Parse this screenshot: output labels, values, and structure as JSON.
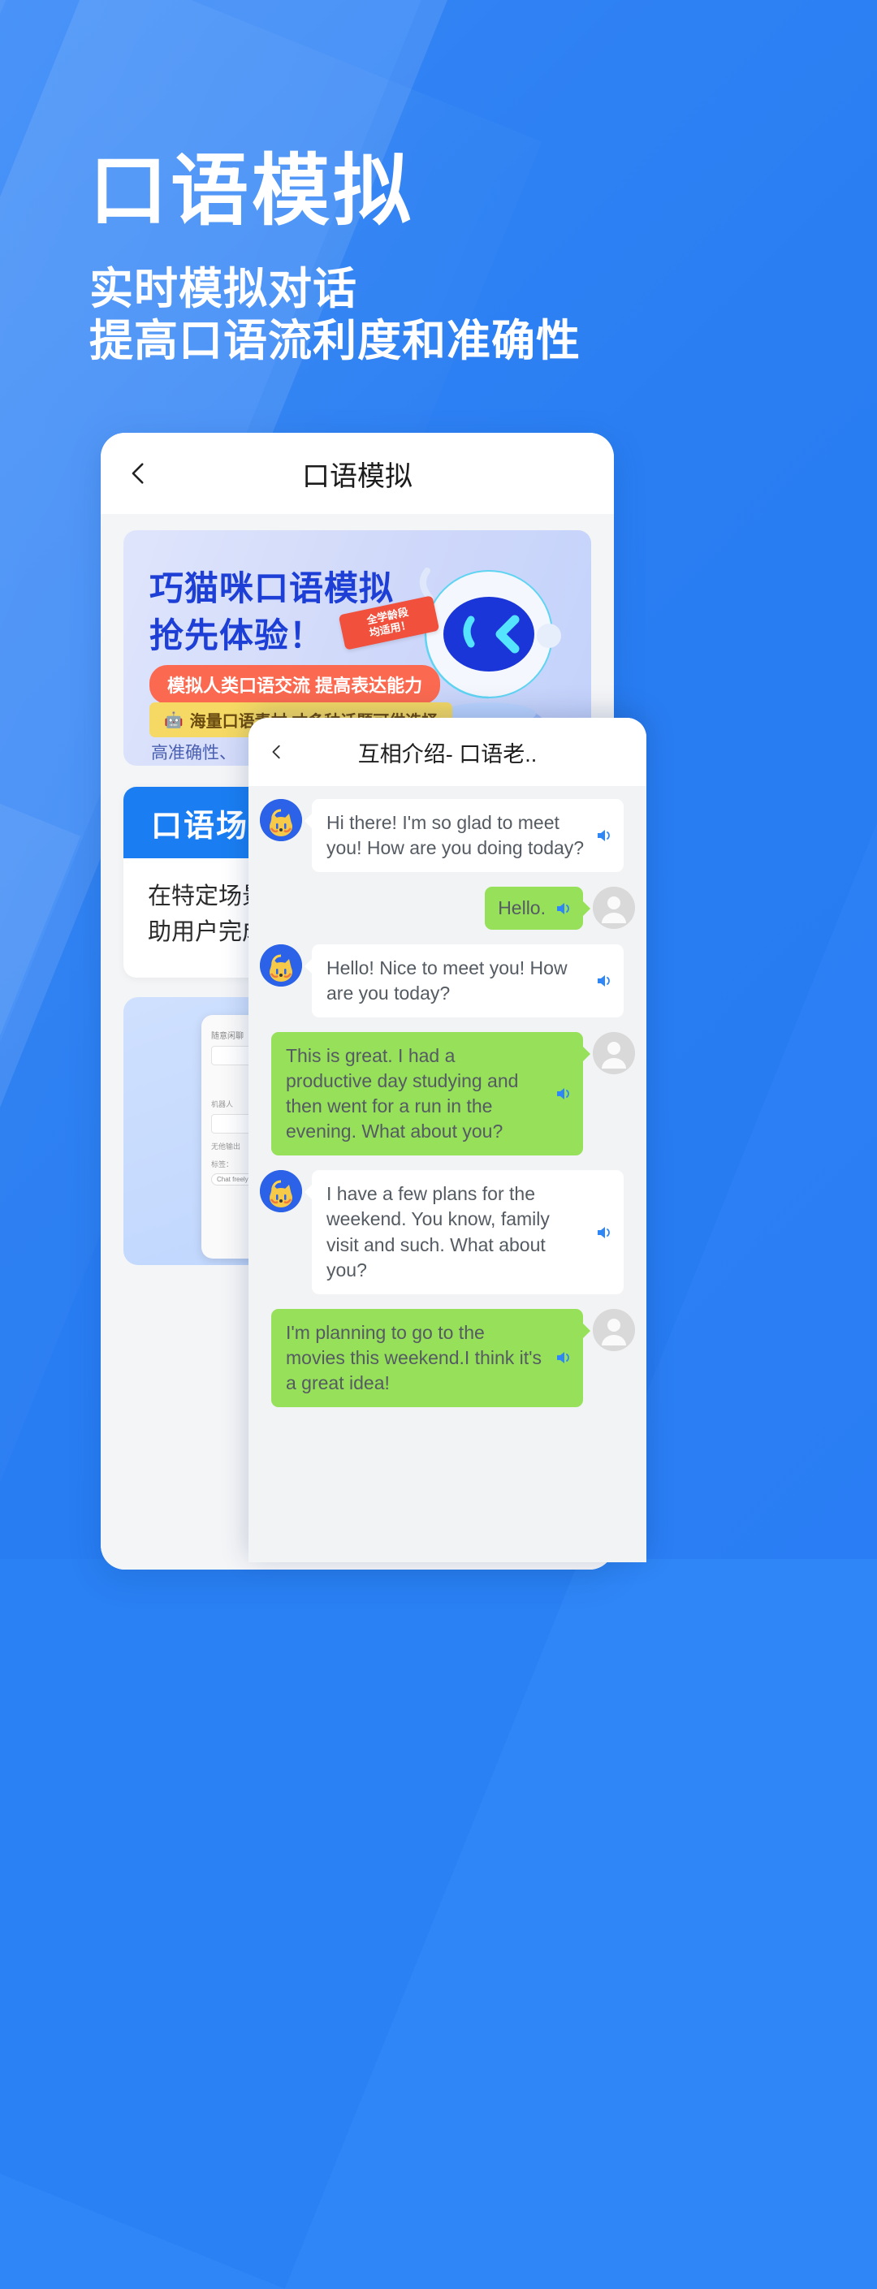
{
  "brand": {
    "accent": "#2f86f6",
    "bot_bubble": "#ffffff",
    "user_bubble": "#96e05a",
    "scene_header": "#1a7ef2"
  },
  "headline": {
    "title": "口语模拟",
    "sub_line1": "实时模拟对话",
    "sub_line2": "提高口语流利度和准确性"
  },
  "phone": {
    "back_icon": "chevron-left-icon",
    "title": "口语模拟",
    "banner": {
      "line1": "巧猫咪口语模拟",
      "line2": "抢先体验！",
      "tag_line1": "全学龄段",
      "tag_line2": "均适用！",
      "pill_red": "模拟人类口语交流 提高表达能力",
      "pill_yellow_icon": "robot-icon",
      "pill_yellow": "海量口语素材 才多种话题可供选择",
      "footer": "高准确性、",
      "robot_icon": "robot-mascot-icon"
    },
    "scene": {
      "header": "口语场景",
      "body_line1": "在特定场景下",
      "body_line2": "助用户完成各"
    },
    "mini": {
      "label_top": "随意闲聊",
      "label_mid": "机器人",
      "placeholder": "无他输出",
      "label_bottom": "标签：",
      "chip": "Chat freely"
    }
  },
  "chat": {
    "back_icon": "chevron-left-icon",
    "title": "互相介绍- 口语老..",
    "speaker_icon": "speaker-icon",
    "bot_avatar": "cat-avatar-icon",
    "user_avatar": "person-avatar-icon",
    "messages": [
      {
        "side": "bot",
        "text": "Hi there! I'm so glad to meet you! How are you doing today?"
      },
      {
        "side": "user",
        "text": "Hello."
      },
      {
        "side": "bot",
        "text": "Hello! Nice to meet you! How are you today?"
      },
      {
        "side": "user",
        "text": "This is great. I had a productive day studying and then went for a run in the evening. What about you?"
      },
      {
        "side": "bot",
        "text": "I have a few plans for the weekend. You know, family visit and such. What about you?"
      },
      {
        "side": "user",
        "text": "I'm planning to go to the movies this weekend.I think it's a great idea!"
      }
    ]
  }
}
